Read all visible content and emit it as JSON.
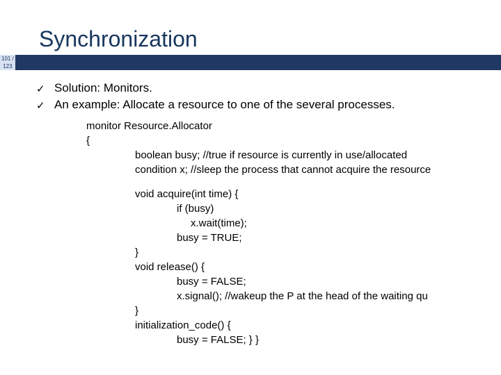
{
  "title": "Synchronization",
  "page_num_top": "101 /",
  "page_num_bot": "123",
  "bullets": {
    "b1": "Solution: Monitors.",
    "b2": "An example: Allocate a resource to one of the several processes."
  },
  "code": {
    "l1": "monitor Resource.Allocator",
    "l2": "{",
    "l3": "boolean busy; //true if resource is currently in use/allocated",
    "l4": "condition x; //sleep the process that cannot acquire the resource",
    "l5": "void acquire(int time) {",
    "l6": "if (busy)",
    "l7": "x.wait(time);",
    "l8": "busy = TRUE;",
    "l9": "}",
    "l10": "void release() {",
    "l11": "busy = FALSE;",
    "l12": "x.signal(); //wakeup the P at the head of the waiting qu",
    "l13": "}",
    "l14": "initialization_code() {",
    "l15": "busy = FALSE; } }"
  }
}
